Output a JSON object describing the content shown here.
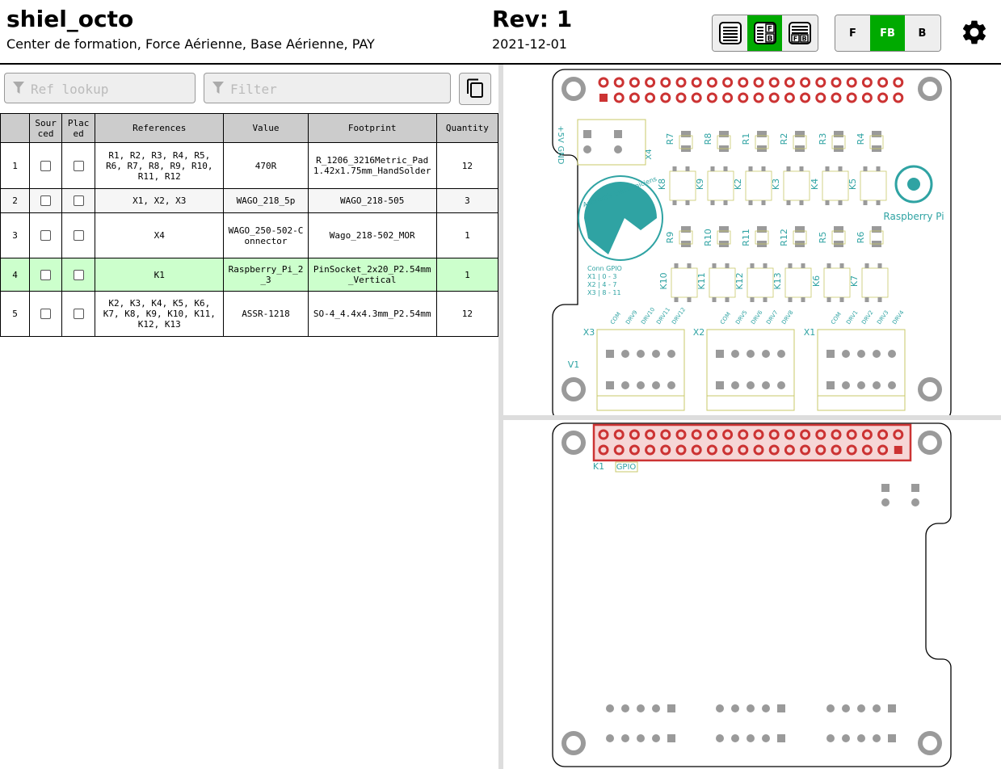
{
  "header": {
    "title": "shiel_octo",
    "company": "Center de formation, Force Aérienne, Base Aérienne, PAY",
    "revision": "Rev: 1",
    "date": "2021-12-01"
  },
  "layout_buttons": {
    "active": "bom-left-drawings-right",
    "options": [
      "bom-only",
      "bom-left-drawings-right",
      "bom-top-drawings-bottom"
    ]
  },
  "side_buttons": {
    "labels": [
      "F",
      "FB",
      "B"
    ],
    "active": "FB"
  },
  "search": {
    "ref_lookup_placeholder": "Ref lookup",
    "filter_placeholder": "Filter"
  },
  "table": {
    "headers": [
      "",
      "Sour\nced",
      "Plac\ned",
      "References",
      "Value",
      "Footprint",
      "Quantity"
    ],
    "rows": [
      {
        "num": "1",
        "refs": "R1, R2, R3, R4, R5, R6, R7, R8, R9, R10, R11, R12",
        "value": "470R",
        "footprint": "R_1206_3216Metric_Pad1.42x1.75mm_HandSolder",
        "qty": "12"
      },
      {
        "num": "2",
        "refs": "X1, X2, X3",
        "value": "WAGO_218_5p",
        "footprint": "WAGO_218-505",
        "qty": "3"
      },
      {
        "num": "3",
        "refs": "X4",
        "value": "WAGO_250-502-Connector",
        "footprint": "Wago_218-502_MOR",
        "qty": "1"
      },
      {
        "num": "4",
        "refs": "K1",
        "value": "Raspberry_Pi_2_3",
        "footprint": "PinSocket_2x20_P2.54mm_Vertical",
        "qty": "1"
      },
      {
        "num": "5",
        "refs": "K2, K3, K4, K5, K6, K7, K8, K9, K10, K11, K12, K13",
        "value": "ASSR-1218",
        "footprint": "SO-4_4.4x4.3mm_P2.54mm",
        "qty": "12"
      }
    ]
  },
  "pcb_front": {
    "resistor_labels_top": [
      "R7",
      "R8",
      "R1",
      "R2",
      "R3",
      "R4"
    ],
    "relay_labels_top": [
      "K8",
      "K9",
      "K2",
      "K3",
      "K4",
      "K5"
    ],
    "resistor_labels_mid": [
      "R9",
      "R10",
      "R11",
      "R12",
      "R5",
      "R6"
    ],
    "relay_labels_bottom": [
      "K10",
      "K11",
      "K12",
      "K13",
      "K6",
      "K7"
    ],
    "power_label": "+5V",
    "gnd_label": "GND",
    "x4_label": "X4",
    "logo_text": "Raspberry Pi",
    "badge_text": "Apprentis Electroniciens",
    "conn_table": [
      "Conn  GPIO",
      "X1  | 0 - 3",
      "X2  | 4 - 7",
      "X3  | 8 - 11"
    ],
    "v1_label": "V1",
    "connectors": [
      {
        "name": "X3",
        "pins": [
          "COM",
          "DRV9",
          "DRV10",
          "DRV11",
          "DRV12"
        ]
      },
      {
        "name": "X2",
        "pins": [
          "COM",
          "DRV5",
          "DRV6",
          "DRV7",
          "DRV8"
        ]
      },
      {
        "name": "X1",
        "pins": [
          "COM",
          "DRV1",
          "DRV2",
          "DRV3",
          "DRV4"
        ]
      }
    ]
  },
  "pcb_back": {
    "k1_label": "K1",
    "gpio_label": "GPIO"
  },
  "colors": {
    "accent": "#00aa00",
    "highlight_row": "#ccffcc",
    "silk": "#2fa3a3",
    "pad_red": "#cc3333",
    "pad_gray": "#9a9a9a",
    "fab": "#c8c86a"
  }
}
